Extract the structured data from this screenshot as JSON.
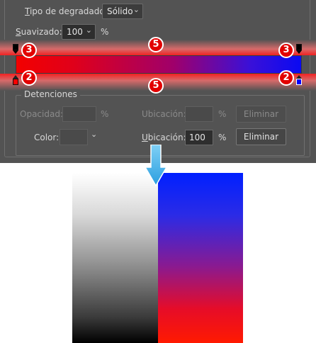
{
  "gradient_type": {
    "label": "Tipo de degradado:",
    "value": "Sólido"
  },
  "smoothness": {
    "label": "Suavizado:",
    "value": "100",
    "unit": "%"
  },
  "gradient": {
    "colors": [
      "#f30000",
      "#0a0af2"
    ],
    "opacity_stop_left_color": "#000000",
    "opacity_stop_right_color": "#000000",
    "color_stop_left_color": "#ff0000",
    "color_stop_right_color": "#0000ff"
  },
  "annotations": {
    "top_left": "3",
    "top_center": "5",
    "top_right": "3",
    "bottom_left": "2",
    "bottom_center": "5",
    "bottom_right": "2"
  },
  "stops": {
    "group_title": "Detenciones",
    "opacity_row": {
      "opacity_label": "Opacidad:",
      "opacity_unit": "%",
      "location_label": "Ubicación:",
      "location_unit": "%",
      "delete_label": "Eliminar"
    },
    "color_row": {
      "color_label": "Color:",
      "location_label": "Ubicación:",
      "location_value": "100",
      "location_unit": "%",
      "delete_label": "Eliminar"
    }
  }
}
